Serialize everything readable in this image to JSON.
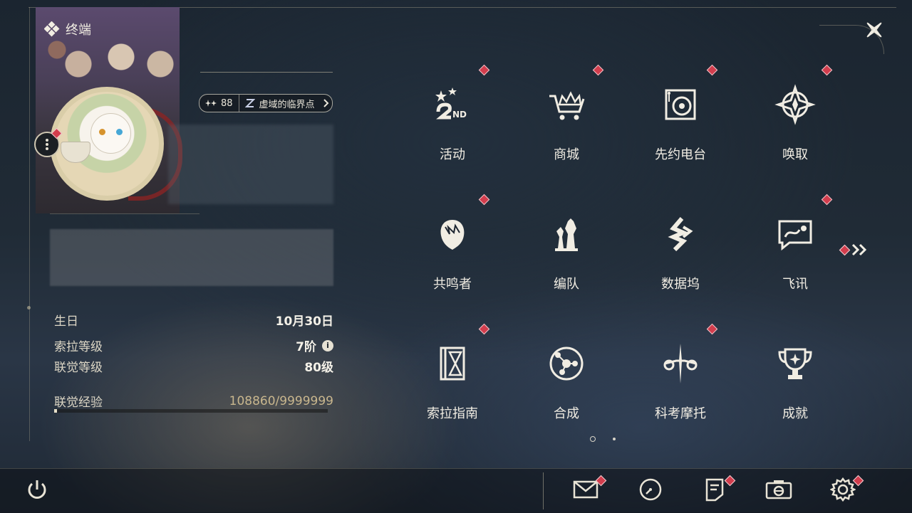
{
  "header": {
    "terminal_label": "终端"
  },
  "profile": {
    "level": "88",
    "title": "虚域的临界点",
    "info": [
      {
        "label": "生日",
        "value": "10月30日"
      },
      {
        "label": "索拉等级",
        "value": "7阶"
      },
      {
        "label": "联觉等级",
        "value": "80级"
      },
      {
        "label": "联觉经验",
        "value": "108860/9999999"
      }
    ],
    "exp_progress": 0.011
  },
  "menu": [
    {
      "label": "活动",
      "icon": "event-2nd-anniversary-icon",
      "badge": true
    },
    {
      "label": "商城",
      "icon": "shop-crown-cart-icon",
      "badge": true
    },
    {
      "label": "先约电台",
      "icon": "radio-icon",
      "badge": true
    },
    {
      "label": "唤取",
      "icon": "summon-compass-icon",
      "badge": true
    },
    {
      "label": "共鸣者",
      "icon": "resonator-portrait-icon",
      "badge": true
    },
    {
      "label": "编队",
      "icon": "team-chess-icon",
      "badge": false
    },
    {
      "label": "数据坞",
      "icon": "data-bank-icon",
      "badge": false
    },
    {
      "label": "飞讯",
      "icon": "message-chat-icon",
      "badge": true
    },
    {
      "label": "索拉指南",
      "icon": "guide-book-icon",
      "badge": true
    },
    {
      "label": "合成",
      "icon": "synthesis-icon",
      "badge": false
    },
    {
      "label": "科考摩托",
      "icon": "motorbike-icon",
      "badge": true
    },
    {
      "label": "成就",
      "icon": "trophy-icon",
      "badge": false
    }
  ],
  "pagination": {
    "current": 1,
    "total": 2
  },
  "bottom_bar": [
    "power-icon",
    "mail-icon",
    "clock-icon",
    "notice-icon",
    "camera-icon",
    "settings-gear-icon"
  ],
  "colors": {
    "badge_red": "#d23d4d",
    "accent_gold": "#c9b78e",
    "text": "#f1ede3"
  }
}
